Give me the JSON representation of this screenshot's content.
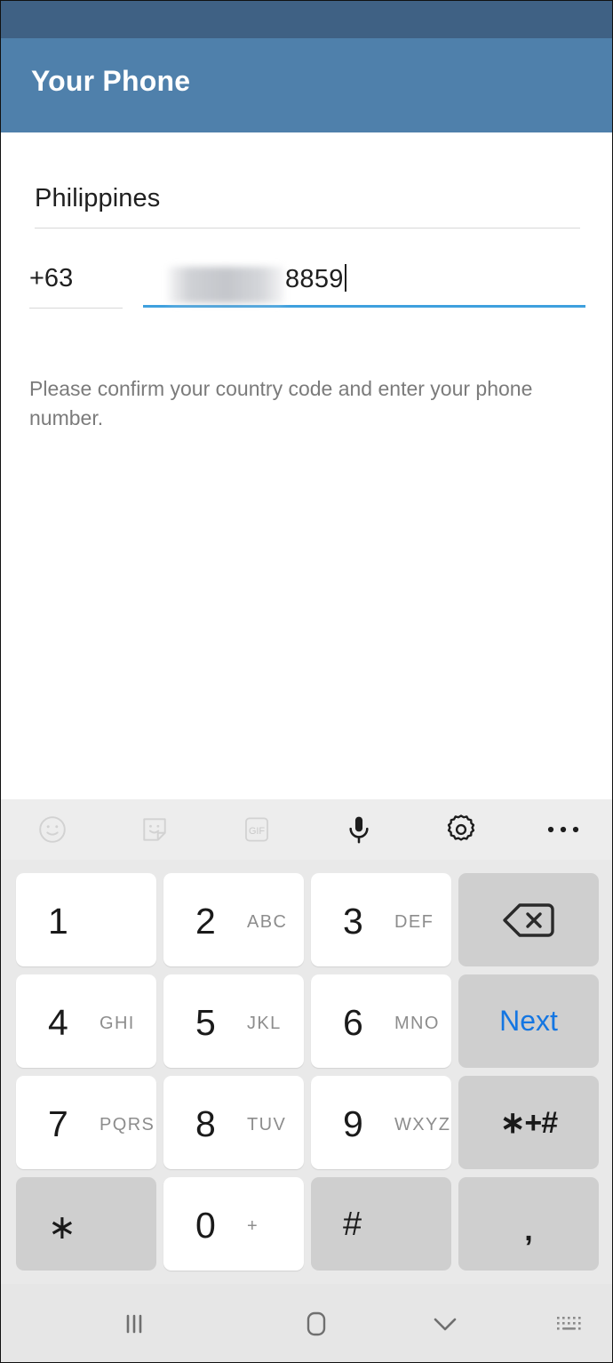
{
  "status_bar": {
    "color": "#3f6184"
  },
  "app_bar": {
    "title": "Your Phone",
    "background": "#4f80ab",
    "title_color": "#ffffff"
  },
  "form": {
    "country_label": "country-field",
    "country_value": "Philippines",
    "country_code": "+63",
    "phone_number_redacted": true,
    "phone_number_visible_digits": "8859",
    "helper_text": "Please confirm your country code and enter your phone number.",
    "focus_underline_color": "#3fa0de"
  },
  "annotation": {
    "arrow_icon": "green-arrow-icon",
    "arrow_fill": "#00e81a",
    "arrow_stroke": "#000000"
  },
  "fab": {
    "icon": "arrow-right-icon",
    "color": "#5ea6de",
    "icon_color": "#ffffff"
  },
  "keyboard": {
    "background": "#e9e9e9",
    "toolbar": [
      {
        "name": "emoji-icon",
        "label": "emoji",
        "state": "dim"
      },
      {
        "name": "sticker-icon",
        "label": "sticker",
        "state": "dim"
      },
      {
        "name": "gif-icon",
        "label": "GIF",
        "state": "dim"
      },
      {
        "name": "microphone-icon",
        "label": "voice",
        "state": "active"
      },
      {
        "name": "gear-icon",
        "label": "settings",
        "state": "active"
      },
      {
        "name": "more-icon",
        "label": "more",
        "state": "active"
      }
    ],
    "rows": [
      [
        {
          "digit": "1",
          "letters": "",
          "type": "white"
        },
        {
          "digit": "2",
          "letters": "ABC",
          "type": "white"
        },
        {
          "digit": "3",
          "letters": "DEF",
          "type": "white"
        },
        {
          "digit": "",
          "letters": "",
          "type": "gray",
          "icon": "backspace-icon"
        }
      ],
      [
        {
          "digit": "4",
          "letters": "GHI",
          "type": "white"
        },
        {
          "digit": "5",
          "letters": "JKL",
          "type": "white"
        },
        {
          "digit": "6",
          "letters": "MNO",
          "type": "white"
        },
        {
          "digit": "",
          "letters": "",
          "type": "gray",
          "text": "Next",
          "text_color": "#1476e2"
        }
      ],
      [
        {
          "digit": "7",
          "letters": "PQRS",
          "type": "white"
        },
        {
          "digit": "8",
          "letters": "TUV",
          "type": "white"
        },
        {
          "digit": "9",
          "letters": "WXYZ",
          "type": "white"
        },
        {
          "digit": "",
          "letters": "",
          "type": "gray",
          "text": "∗+#"
        }
      ],
      [
        {
          "digit": "∗",
          "letters": "",
          "type": "gray"
        },
        {
          "digit": "0",
          "letters": "+",
          "type": "white"
        },
        {
          "digit": "#",
          "letters": "",
          "type": "gray"
        },
        {
          "digit": "",
          "letters": "",
          "type": "gray",
          "text": ","
        }
      ]
    ],
    "key_labels": {
      "k1": "1",
      "k2": "2",
      "k2l": "ABC",
      "k3": "3",
      "k3l": "DEF",
      "k4": "4",
      "k4l": "GHI",
      "k5": "5",
      "k5l": "JKL",
      "k6": "6",
      "k6l": "MNO",
      "k7": "7",
      "k7l": "PQRS",
      "k8": "8",
      "k8l": "TUV",
      "k9": "9",
      "k9l": "WXYZ",
      "kstar": "∗",
      "k0": "0",
      "k0l": "+",
      "khash": "#",
      "knext": "Next",
      "ksympad": "∗+#",
      "kcomma": ",",
      "kgif": "GIF"
    }
  },
  "nav_bar": {
    "background": "#e6e6e6",
    "items": [
      {
        "name": "recents-icon",
        "label": "recents"
      },
      {
        "name": "home-icon",
        "label": "home"
      },
      {
        "name": "hide-keyboard-icon",
        "label": "hide keyboard"
      },
      {
        "name": "keyboard-switch-icon",
        "label": "switch keyboard"
      }
    ]
  }
}
